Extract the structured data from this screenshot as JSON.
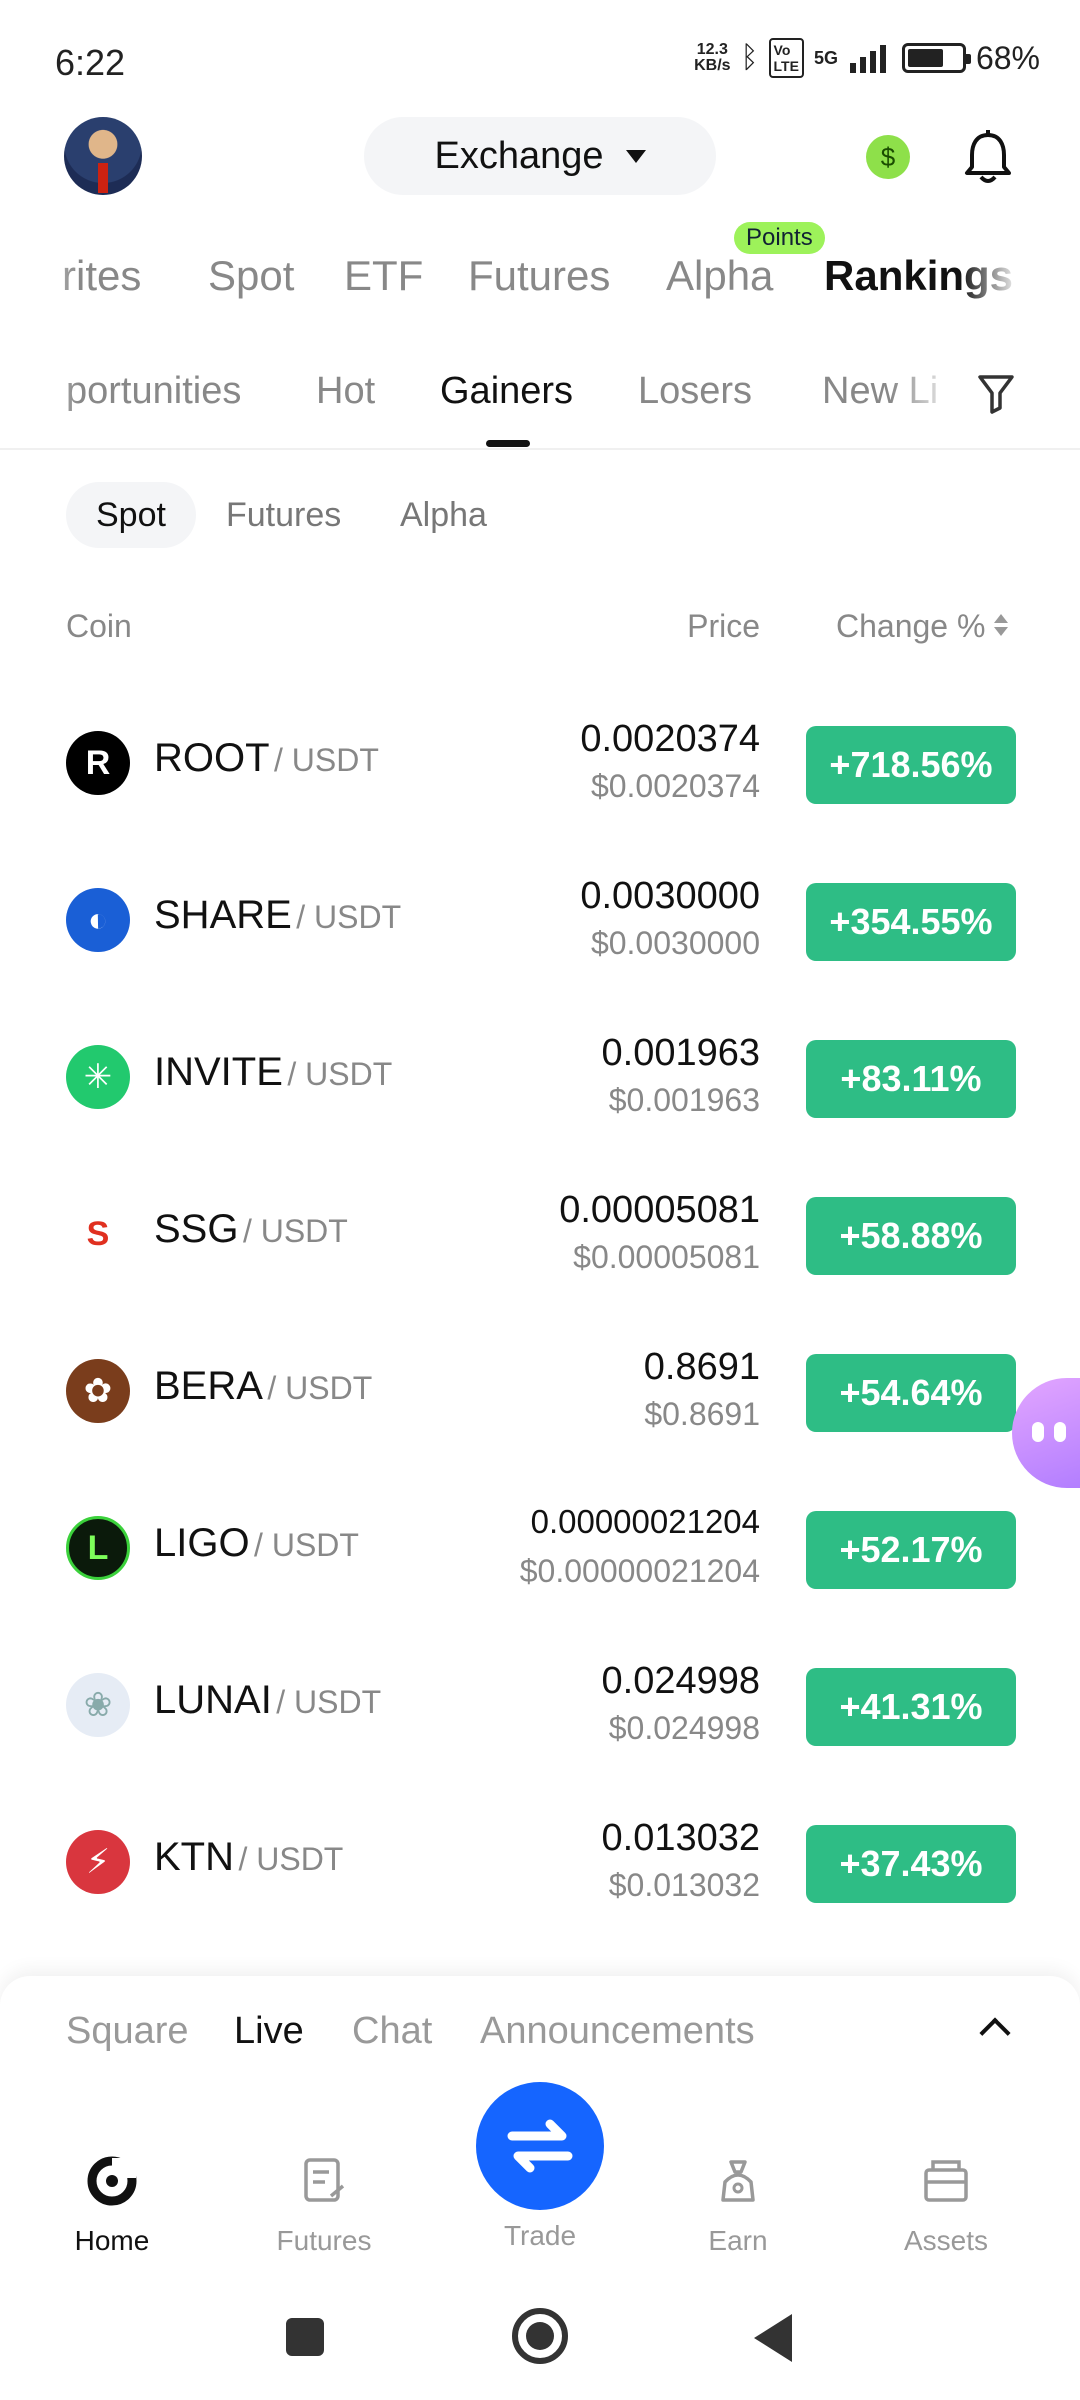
{
  "status_bar": {
    "time": "6:22",
    "net_speed_value": "12.3",
    "net_speed_unit": "KB/s",
    "network": "5G",
    "battery": "68%",
    "battery_level": 0.68
  },
  "header": {
    "exchange_label": "Exchange",
    "coin_symbol": "$"
  },
  "category_tabs": [
    {
      "label": "rites"
    },
    {
      "label": "Spot"
    },
    {
      "label": "ETF"
    },
    {
      "label": "Futures"
    },
    {
      "label": "Alpha"
    },
    {
      "label": "Rankings"
    }
  ],
  "points_badge": "Points",
  "sub_tabs": [
    {
      "label": "portunities"
    },
    {
      "label": "Hot"
    },
    {
      "label": "Gainers"
    },
    {
      "label": "Losers"
    },
    {
      "label": "New Li"
    }
  ],
  "market_segments": [
    {
      "label": "Spot"
    },
    {
      "label": "Futures"
    },
    {
      "label": "Alpha"
    }
  ],
  "columns": {
    "coin": "Coin",
    "price": "Price",
    "change": "Change %"
  },
  "rows": [
    {
      "base": "ROOT",
      "quote": "/ USDT",
      "price": "0.0020374",
      "usd": "$0.0020374",
      "change": "+718.56%",
      "logo_text": "R",
      "logo_color": "#000000"
    },
    {
      "base": "SHARE",
      "quote": "/ USDT",
      "price": "0.0030000",
      "usd": "$0.0030000",
      "change": "+354.55%",
      "logo_text": "◐",
      "logo_color": "#1a5fd6"
    },
    {
      "base": "INVITE",
      "quote": "/ USDT",
      "price": "0.001963",
      "usd": "$0.001963",
      "change": "+83.11%",
      "logo_text": "✳",
      "logo_color": "#22c96e"
    },
    {
      "base": "SSG",
      "quote": "/ USDT",
      "price": "0.00005081",
      "usd": "$0.00005081",
      "change": "+58.88%",
      "logo_text": "S",
      "logo_color": "#ffffff"
    },
    {
      "base": "BERA",
      "quote": "/ USDT",
      "price": "0.8691",
      "usd": "$0.8691",
      "change": "+54.64%",
      "logo_text": "✿",
      "logo_color": "#7a3d1c"
    },
    {
      "base": "LIGO",
      "quote": "/ USDT",
      "price": "0.00000021204",
      "usd": "$0.00000021204",
      "change": "+52.17%",
      "logo_text": "L",
      "logo_color": "#0b1a0b"
    },
    {
      "base": "LUNAI",
      "quote": "/ USDT",
      "price": "0.024998",
      "usd": "$0.024998",
      "change": "+41.31%",
      "logo_text": "❀",
      "logo_color": "#e6ecf5"
    },
    {
      "base": "KTN",
      "quote": "/ USDT",
      "price": "0.013032",
      "usd": "$0.013032",
      "change": "+37.43%",
      "logo_text": "⚡",
      "logo_color": "#d9363e"
    }
  ],
  "feed_tabs": [
    {
      "label": "Square"
    },
    {
      "label": "Live"
    },
    {
      "label": "Chat"
    },
    {
      "label": "Announcements"
    }
  ],
  "bottom_nav": {
    "home": "Home",
    "futures": "Futures",
    "trade": "Trade",
    "earn": "Earn",
    "assets": "Assets"
  },
  "colors": {
    "gain_green": "#2ebd85",
    "trade_blue": "#1565ff",
    "points_green": "#9df25a"
  }
}
